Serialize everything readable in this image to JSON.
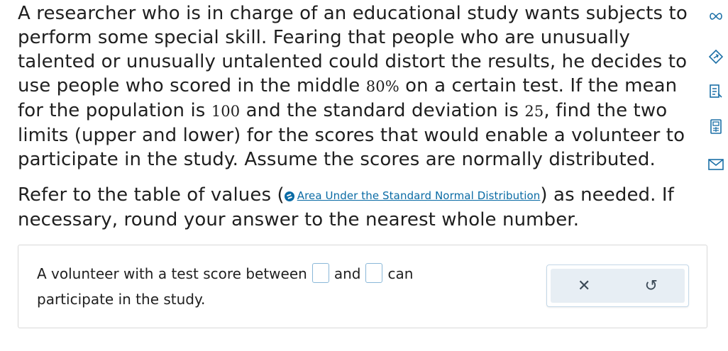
{
  "problem": {
    "p1_a": "A researcher who is in charge of an educational study wants subjects to perform some special skill. Fearing that people who are unusually talented or unusually untalented could distort the results, he decides to use people who scored in the middle ",
    "pct": "80%",
    "p1_b": " on a certain test. If the mean for the population is ",
    "mean": "100",
    "p1_c": " and the standard deviation is ",
    "sd": "25",
    "p1_d": ", find the two limits (upper and lower) for the scores that would enable a volunteer to participate in the study. Assume the scores are normally distributed.",
    "p2_a": "Refer to the table of values (",
    "link_label": "Area Under the Standard Normal Distribution",
    "p2_b": ") as needed. If necessary, round your answer to the nearest whole number."
  },
  "answer": {
    "text_a": "A volunteer with a test score between",
    "text_b": "and",
    "text_c": "can participate in the study."
  },
  "actions": {
    "clear_symbol": "✕",
    "undo_symbol": "↺"
  },
  "sidebar": {
    "icons": [
      "infinity-icon",
      "compass-icon",
      "notes-icon",
      "calculator-icon",
      "mail-icon"
    ]
  },
  "colors": {
    "accent": "#1b6fa6",
    "link": "#0a6ba5",
    "input_border": "#8ab8d8"
  }
}
